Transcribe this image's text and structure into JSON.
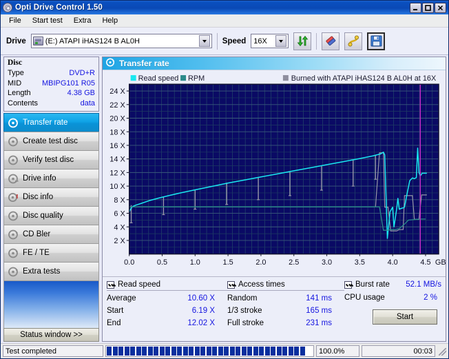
{
  "window": {
    "title": "Opti Drive Control 1.50",
    "app_icon": "disc-icon",
    "minimize_label": "_",
    "maximize_label": "□",
    "close_label": "✕"
  },
  "menu": [
    {
      "label": "File"
    },
    {
      "label": "Start test"
    },
    {
      "label": "Extra"
    },
    {
      "label": "Help"
    }
  ],
  "toolbar": {
    "drive_label": "Drive",
    "drive_value": "(E:)  ATAPI iHAS124   B AL0H",
    "speed_label": "Speed",
    "speed_value": "16X",
    "buttons": [
      {
        "name": "refresh-icon",
        "title": "Refresh"
      },
      {
        "name": "eraser-icon",
        "title": "Erase"
      },
      {
        "name": "cable-icon",
        "title": "Extra"
      },
      {
        "name": "save-icon",
        "title": "Save"
      }
    ]
  },
  "sidebar": {
    "disc": {
      "title": "Disc",
      "rows": [
        {
          "key": "Type",
          "value": "DVD+R"
        },
        {
          "key": "MID",
          "value": "MBIPG101 R05"
        },
        {
          "key": "Length",
          "value": "4.38 GB"
        },
        {
          "key": "Contents",
          "value": "data"
        }
      ]
    },
    "items": [
      {
        "label": "Transfer rate",
        "icon": "disc-transfer-icon",
        "active": true
      },
      {
        "label": "Create test disc",
        "icon": "disc-create-icon",
        "active": false
      },
      {
        "label": "Verify test disc",
        "icon": "disc-verify-icon",
        "active": false
      },
      {
        "label": "Drive info",
        "icon": "disc-drive-icon",
        "active": false
      },
      {
        "label": "Disc info",
        "icon": "disc-info-icon",
        "active": false
      },
      {
        "label": "Disc quality",
        "icon": "disc-quality-icon",
        "active": false
      },
      {
        "label": "CD Bler",
        "icon": "disc-bler-icon",
        "active": false
      },
      {
        "label": "FE / TE",
        "icon": "disc-fete-icon",
        "active": false
      },
      {
        "label": "Extra tests",
        "icon": "disc-extra-icon",
        "active": false
      }
    ],
    "status_window_button": "Status window >>"
  },
  "main": {
    "header_title": "Transfer rate",
    "header_icon": "disc-transfer-icon"
  },
  "chart_data": {
    "type": "line",
    "title": "Transfer rate",
    "xlabel": "GB",
    "ylabel": "X",
    "xlim": [
      0.0,
      4.7
    ],
    "ylim": [
      0,
      25
    ],
    "xticks": [
      "0.0",
      "0.5",
      "1.0",
      "1.5",
      "2.0",
      "2.5",
      "3.0",
      "3.5",
      "4.0",
      "4.5"
    ],
    "xtick_values": [
      0.0,
      0.5,
      1.0,
      1.5,
      2.0,
      2.5,
      3.0,
      3.5,
      4.0,
      4.5
    ],
    "x_unit": "GB",
    "yticks": [
      "2 X",
      "4 X",
      "6 X",
      "8 X",
      "10 X",
      "12 X",
      "14 X",
      "16 X",
      "18 X",
      "20 X",
      "22 X",
      "24 X"
    ],
    "ytick_values": [
      2,
      4,
      6,
      8,
      10,
      12,
      14,
      16,
      18,
      20,
      22,
      24
    ],
    "grid": true,
    "legend_position": "top",
    "legend": [
      {
        "label": "Read speed",
        "color": "#19e8f0"
      },
      {
        "label": "RPM",
        "color": "#2a8a8a"
      }
    ],
    "annotation": "Burned with ATAPI iHAS124   B AL0H at 16X",
    "annotation_color": "#8e8e9e",
    "plot_bg": "#0a0a64",
    "grid_color": "#2a4a6a",
    "marker_line_color": "#c828c8",
    "marker_line_x": 4.42,
    "series": [
      {
        "name": "Read speed",
        "color": "#19e8f0",
        "x": [
          0.0,
          0.02,
          0.05,
          0.1,
          0.18,
          0.3,
          0.45,
          0.6,
          0.8,
          1.0,
          1.25,
          1.5,
          1.75,
          2.0,
          2.25,
          2.5,
          2.75,
          3.0,
          3.25,
          3.5,
          3.7,
          3.82,
          3.86,
          3.88,
          3.92,
          3.96,
          4.0,
          4.02,
          4.06,
          4.08,
          4.1,
          4.14,
          4.16,
          4.18,
          4.22,
          4.26,
          4.3,
          4.33,
          4.36,
          4.38,
          4.4,
          4.42,
          4.45,
          4.48,
          4.52
        ],
        "y": [
          6.19,
          6.6,
          7.0,
          7.2,
          7.45,
          7.85,
          8.25,
          8.6,
          9.05,
          9.45,
          9.95,
          10.45,
          10.9,
          11.35,
          11.8,
          12.25,
          12.7,
          13.15,
          13.6,
          14.05,
          14.45,
          14.75,
          15.0,
          14.6,
          2.3,
          6.2,
          6.9,
          4.0,
          6.55,
          8.2,
          6.6,
          6.75,
          6.8,
          6.9,
          8.9,
          10.8,
          11.2,
          11.1,
          11.25,
          15.6,
          12.02,
          11.5,
          11.9,
          11.9,
          11.9
        ]
      },
      {
        "name": "RPM",
        "color": "#2a8a8a",
        "x": [
          0.0,
          0.05,
          0.2,
          0.6,
          1.2,
          2.0,
          2.8,
          3.4,
          3.7,
          3.8,
          3.86,
          3.92,
          3.98,
          4.04,
          4.1,
          4.18,
          4.24,
          4.3,
          4.36,
          4.42,
          4.5
        ],
        "y": [
          6.95,
          6.95,
          6.95,
          6.95,
          6.95,
          6.95,
          6.95,
          6.95,
          6.95,
          6.95,
          3.5,
          3.5,
          3.6,
          3.6,
          3.75,
          4.4,
          5.0,
          5.05,
          5.1,
          5.15,
          5.15
        ]
      }
    ],
    "access_spikes": {
      "color": "#9898a8",
      "note": "downward gray access-time spikes dropping from the read-speed curve",
      "points": [
        {
          "x": 0.03,
          "top": 7.2,
          "bottom": 4.6
        },
        {
          "x": 0.52,
          "top": 8.4,
          "bottom": 5.8
        },
        {
          "x": 1.0,
          "top": 9.5,
          "bottom": 6.6
        },
        {
          "x": 1.48,
          "top": 10.5,
          "bottom": 7.3
        },
        {
          "x": 1.96,
          "top": 11.3,
          "bottom": 8.0
        },
        {
          "x": 2.44,
          "top": 12.2,
          "bottom": 8.6
        },
        {
          "x": 2.92,
          "top": 13.0,
          "bottom": 9.4
        },
        {
          "x": 3.4,
          "top": 13.9,
          "bottom": 10.0
        },
        {
          "x": 3.74,
          "top": 14.6,
          "bottom": 11.0
        }
      ]
    }
  },
  "stats": {
    "read_speed": {
      "checkbox_label": "Read speed",
      "checked": true,
      "rows": [
        {
          "key": "Average",
          "value": "10.60 X"
        },
        {
          "key": "Start",
          "value": "6.19 X"
        },
        {
          "key": "End",
          "value": "12.02 X"
        }
      ]
    },
    "access_times": {
      "checkbox_label": "Access times",
      "checked": true,
      "rows": [
        {
          "key": "Random",
          "value": "141 ms"
        },
        {
          "key": "1/3 stroke",
          "value": "165 ms"
        },
        {
          "key": "Full stroke",
          "value": "231 ms"
        }
      ]
    },
    "burst": {
      "checkbox_label": "Burst rate",
      "checked": true,
      "value": "52.1 MB/s",
      "rows": [
        {
          "key": "CPU usage",
          "value": "2 %"
        }
      ]
    },
    "start_button": "Start"
  },
  "statusbar": {
    "message": "Test completed",
    "progress_percent": "100.0%",
    "progress_value": 100,
    "elapsed": "00:03"
  },
  "colors": {
    "title_blue": "#0a4fbf",
    "accent_cyan": "#19e8f0",
    "value_blue": "#1414e0",
    "plot_bg": "#0a0a64",
    "progress_fill": "#0a2f9e"
  }
}
